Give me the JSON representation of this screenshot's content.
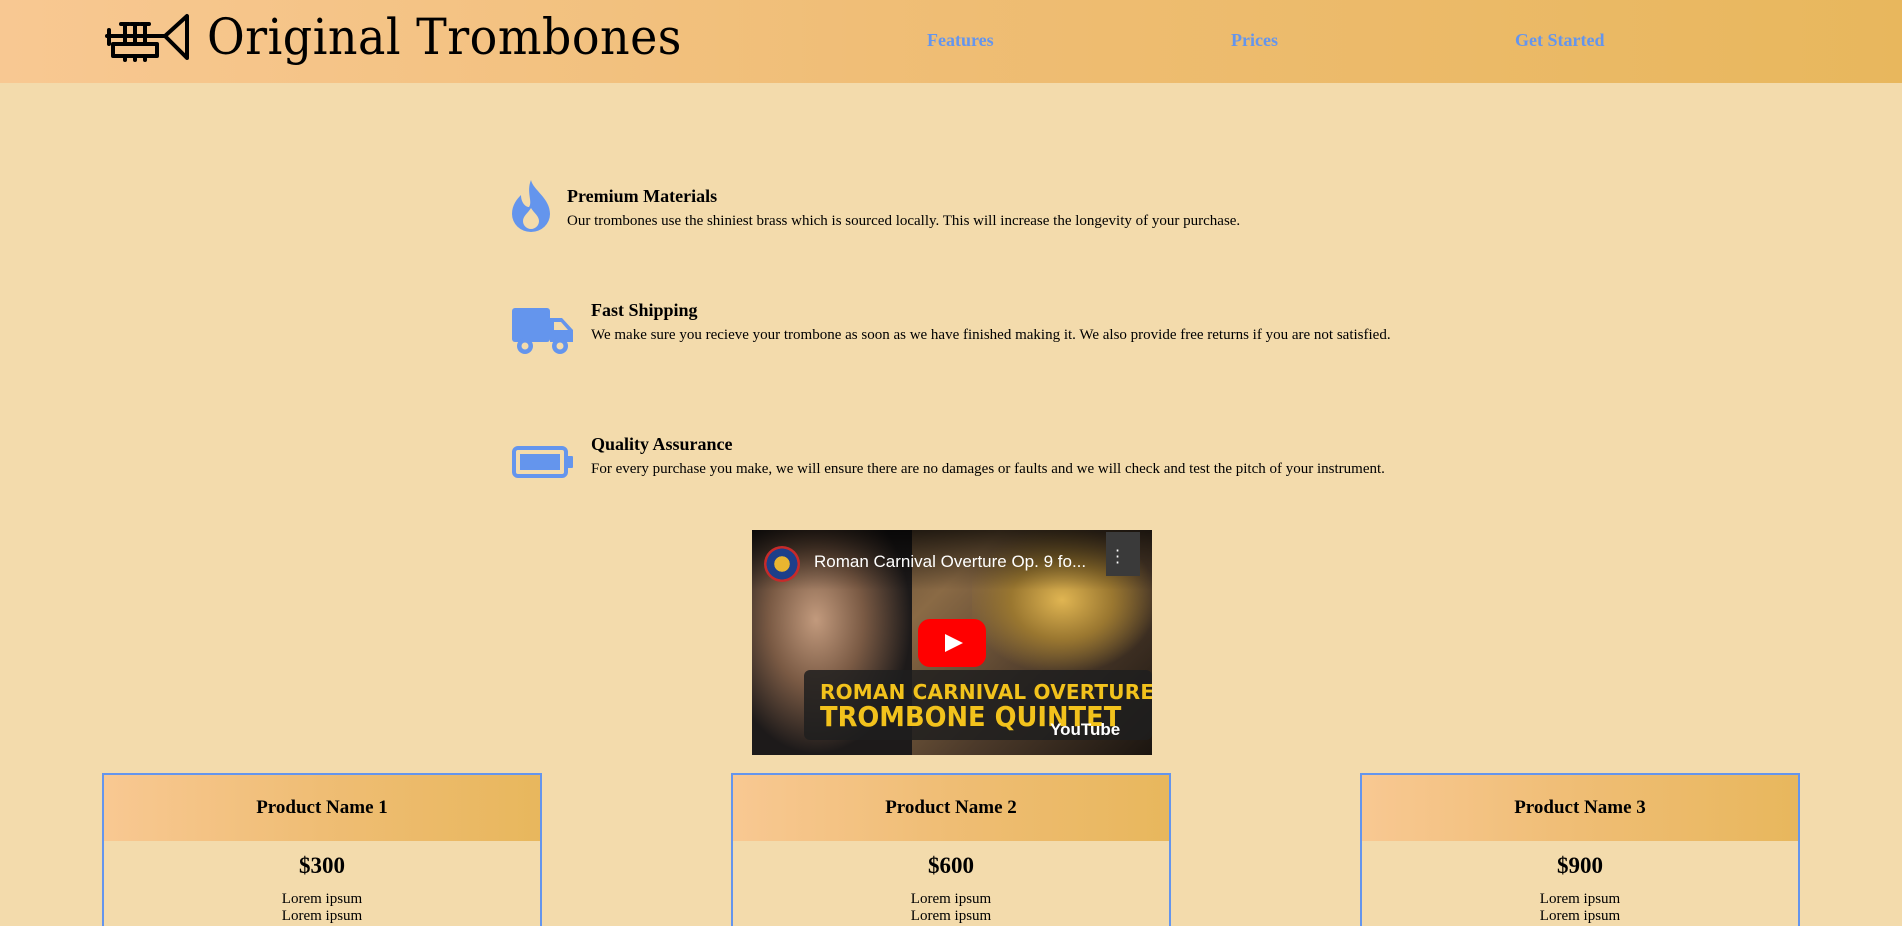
{
  "header": {
    "brand": "Original Trombones",
    "nav": [
      {
        "label": "Features"
      },
      {
        "label": "Prices"
      },
      {
        "label": "Get Started"
      }
    ]
  },
  "features": [
    {
      "icon": "fire-icon",
      "title": "Premium Materials",
      "text": "Our trombones use the shiniest brass which is sourced locally. This will increase the longevity of your purchase."
    },
    {
      "icon": "truck-icon",
      "title": "Fast Shipping",
      "text": "We make sure you recieve your trombone as soon as we have finished making it. We also provide free returns if you are not satisfied."
    },
    {
      "icon": "battery-icon",
      "title": "Quality Assurance",
      "text": "For every purchase you make, we will ensure there are no damages or faults and we will check and test the pitch of your instrument."
    }
  ],
  "video": {
    "title": "Roman Carnival Overture Op. 9 fo...",
    "banner_line1": "ROMAN CARNIVAL OVERTURE",
    "banner_line2": "TROMBONE QUINTET",
    "platform": "YouTube"
  },
  "products": [
    {
      "name": "Product Name 1",
      "price": "$300",
      "lines": [
        "Lorem ipsum",
        "Lorem ipsum"
      ]
    },
    {
      "name": "Product Name 2",
      "price": "$600",
      "lines": [
        "Lorem ipsum",
        "Lorem ipsum"
      ]
    },
    {
      "name": "Product Name 3",
      "price": "$900",
      "lines": [
        "Lorem ipsum",
        "Lorem ipsum"
      ]
    }
  ],
  "colors": {
    "background": "#f3dbac",
    "accent": "#6495ed",
    "header_gradient_start": "#f8c892",
    "header_gradient_end": "#e8b75d"
  }
}
